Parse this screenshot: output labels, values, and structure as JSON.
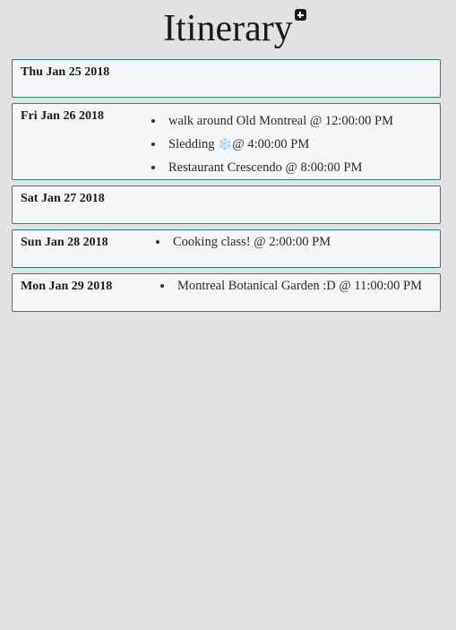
{
  "header": {
    "title": "Itinerary"
  },
  "days": [
    {
      "date": "Thu Jan 25 2018",
      "events": []
    },
    {
      "date": "Fri Jan 26 2018",
      "events": [
        {
          "name": "walk around Old Montreal",
          "time": "12:00:00 PM"
        },
        {
          "name": "Sledding",
          "emoji": "❄️",
          "time": "4:00:00 PM"
        },
        {
          "name": "Restaurant Crescendo",
          "time": "8:00:00 PM"
        }
      ]
    },
    {
      "date": "Sat Jan 27 2018",
      "events": []
    },
    {
      "date": "Sun Jan 28 2018",
      "events": [
        {
          "name": "Cooking class!",
          "time": "2:00:00 PM"
        }
      ]
    },
    {
      "date": "Mon Jan 29 2018",
      "events": [
        {
          "name": "Montreal Botanical Garden :D",
          "time": "11:00:00 PM"
        }
      ]
    }
  ]
}
